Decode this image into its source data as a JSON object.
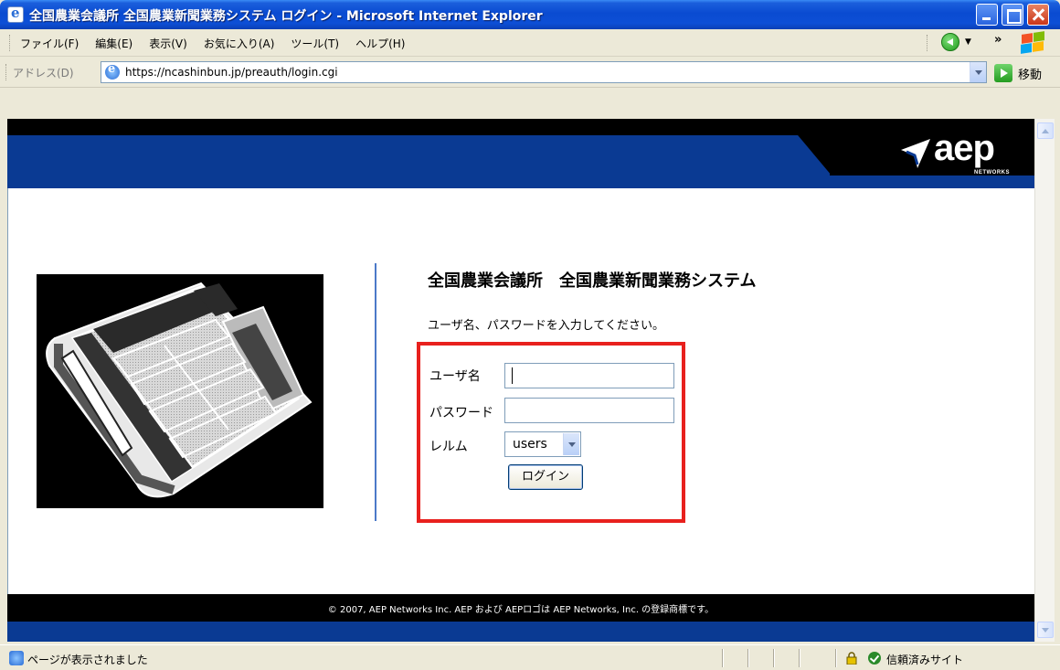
{
  "window": {
    "title": "全国農業会議所 全国農業新聞業務システム ログイン - Microsoft Internet Explorer"
  },
  "menu": {
    "items": [
      "ファイル(F)",
      "編集(E)",
      "表示(V)",
      "お気に入り(A)",
      "ツール(T)",
      "ヘルプ(H)"
    ],
    "overflow": "»"
  },
  "address_bar": {
    "label": "アドレス(D)",
    "url": "https://ncashinbun.jp/preauth/login.cgi",
    "go_label": "移動"
  },
  "brand": {
    "logo_text": "aep",
    "logo_subtext": "NETWORKS"
  },
  "login": {
    "system_title": "全国農業会議所　全国農業新聞業務システム",
    "instruction": "ユーザ名、パスワードを入力してください。",
    "username_label": "ユーザ名",
    "username_value": "",
    "password_label": "パスワード",
    "password_value": "",
    "realm_label": "レルム",
    "realm_selected": "users",
    "submit_label": "ログイン"
  },
  "footer": {
    "copyright": "© 2007, AEP Networks Inc. AEP および AEPロゴは AEP Networks, Inc. の登録商標です。"
  },
  "status_bar": {
    "message": "ページが表示されました",
    "zone": "信頼済みサイト"
  },
  "colors": {
    "title_bar": "#0a4bd1",
    "header_blue": "#0a3a93",
    "highlight_box": "#e8201d",
    "divider": "#4b79c8"
  }
}
